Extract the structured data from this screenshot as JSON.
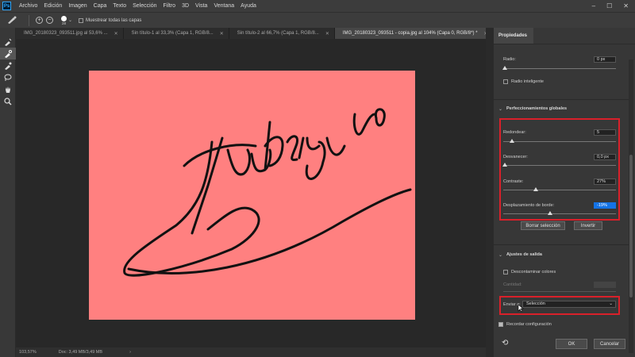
{
  "menu": {
    "logo": "Ps",
    "items": [
      "Archivo",
      "Edición",
      "Imagen",
      "Capa",
      "Texto",
      "Selección",
      "Filtro",
      "3D",
      "Vista",
      "Ventana",
      "Ayuda"
    ],
    "window_controls": [
      "–",
      "☐",
      "✕"
    ]
  },
  "options_bar": {
    "brush_size": "28",
    "sample_all_layers": "Muestrear todas las capas"
  },
  "tabs": [
    {
      "label": "IMG_20180323_093511.jpg al 53,6% ...",
      "active": false
    },
    {
      "label": "Sin título-1 al 33,3% (Capa 1, RGB/8...",
      "active": false
    },
    {
      "label": "Sin título-2 al 66,7% (Capa 1, RGB/8...",
      "active": false
    },
    {
      "label": "IMG_20180323_093511 - copia.jpg al 104% (Capa 0, RGB/8*) *",
      "active": true
    }
  ],
  "document": {
    "background_color": "#ff8080",
    "content": "handwritten signature"
  },
  "status": {
    "zoom": "103,57%",
    "doc_size": "Doc: 3,49 MB/3,49 MB",
    "arrow": "›"
  },
  "panel": {
    "tab_label": "Propiedades",
    "radius_label": "Radio:",
    "radius_value": "0 px",
    "smart_radius_label": "Radio inteligente",
    "global_section_title": "Perfeccionamientos globales",
    "smooth_label": "Redondear:",
    "smooth_value": "5",
    "feather_label": "Desvanecer:",
    "feather_value": "0,0 px",
    "contrast_label": "Contraste:",
    "contrast_value": "27%",
    "shift_label": "Desplazamiento de borde:",
    "shift_value": "-19%",
    "clear_selection": "Borrar selección",
    "invert": "Invertir",
    "output_section_title": "Ajustes de salida",
    "decontaminate_label": "Descontaminar colores",
    "amount_label": "Cantidad:",
    "output_to_label": "Enviar a:",
    "output_to_value": "Selección",
    "remember_label": "Recordar configuración",
    "ok": "OK",
    "cancel": "Cancelar",
    "highlight_color": "#d9202a"
  }
}
